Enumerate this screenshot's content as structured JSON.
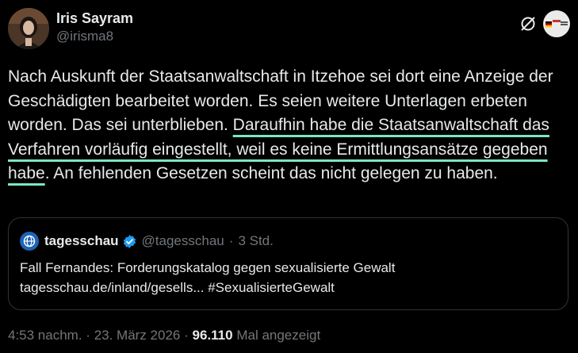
{
  "author": {
    "name": "Iris Sayram",
    "handle": "@irisma8"
  },
  "tweet": {
    "before": "Nach Auskunft der Staatsanwaltschaft in Itzehoe sei dort eine Anzeige der Geschädigten bearbeitet worden. Es seien weitere Unterlagen erbeten worden. Das sei unterblieben. ",
    "highlighted": "Daraufhin habe die Staatsanwaltschaft das Verfahren vorläufig eingestellt, weil es keine Ermittlungsansätze gegeben habe",
    "after": ". An fehlenden Gesetzen scheint das nicht gelegen zu haben.",
    "highlight_color": "#7be6c6"
  },
  "quote": {
    "name": "tagesschau",
    "handle": "@tagesschau",
    "separator": "·",
    "time": "3 Std.",
    "line1": "Fall Fernandes: Forderungskatalog gegen sexualisierte Gewalt",
    "line2": "tagesschau.de/inland/gesells... #SexualisierteGewalt",
    "logo_color": "#1d64b5",
    "verified_color": "#1d9bf0"
  },
  "meta": {
    "time": "4:53 nachm.",
    "sep1": "·",
    "date": "23. März 2026",
    "sep2": "·",
    "views": "96.110",
    "views_label": "Mal angezeigt"
  },
  "icons": {
    "header_left": "grok-icon",
    "header_right": "profile-badge-icon"
  }
}
